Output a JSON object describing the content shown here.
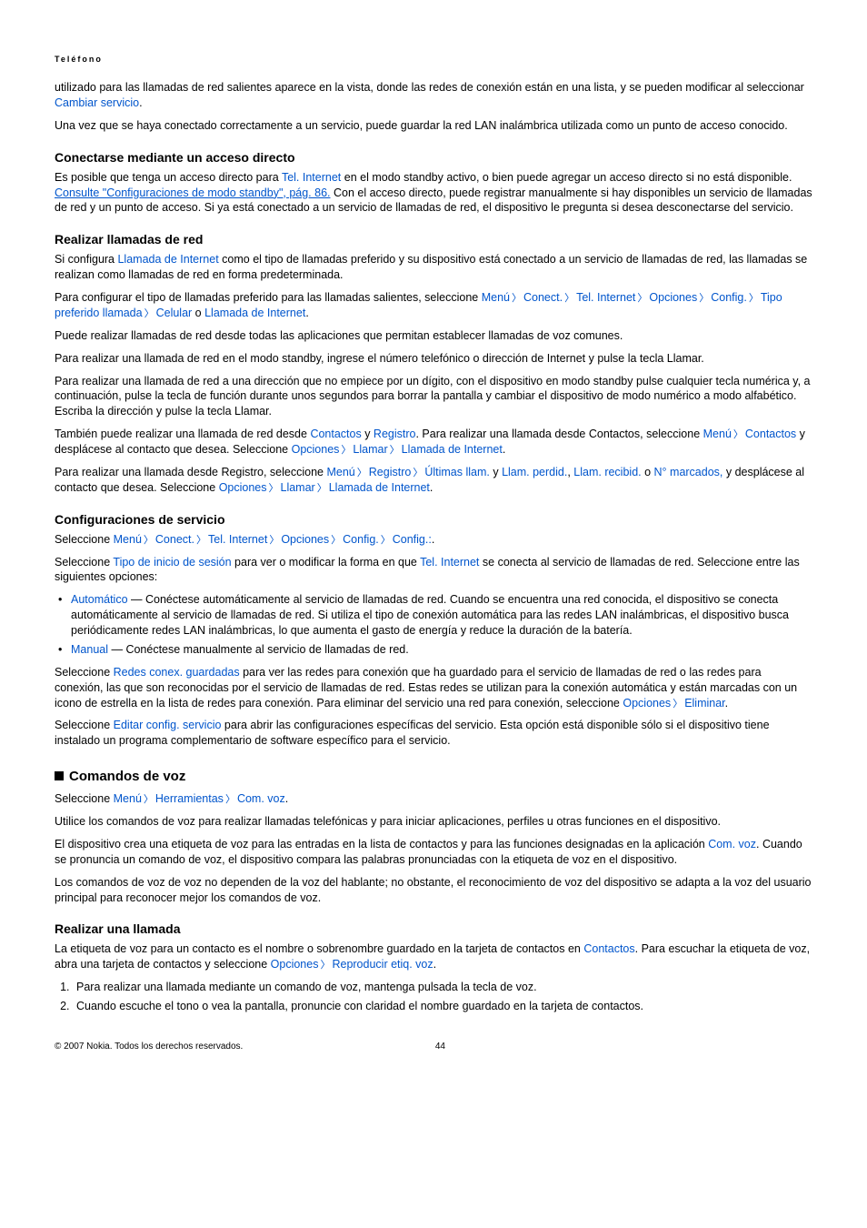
{
  "header": "Teléfono",
  "p1a": "utilizado para las llamadas de red salientes aparece en la vista, donde las redes de conexión están en una lista, y se pueden modificar al seleccionar ",
  "p1_link": "Cambiar servicio",
  "p2": "Una vez que se haya conectado correctamente a un servicio, puede guardar la red LAN inalámbrica utilizada como un punto de acceso conocido.",
  "s1_title": "Conectarse mediante un acceso directo",
  "s1_p1a": "Es posible que tenga un acceso directo para ",
  "s1_p1b": "Tel. Internet",
  "s1_p1c": " en el modo standby activo, o bien puede agregar un acceso directo si no está disponible. ",
  "s1_p1d": "Consulte \"Configuraciones de modo standby\", pág. 86.",
  "s1_p1e": " Con el acceso directo, puede registrar manualmente si hay disponibles un servicio de llamadas de red y un punto de acceso. Si ya está conectado a un servicio de llamadas de red, el dispositivo le pregunta si desea desconectarse del servicio.",
  "s2_title": "Realizar llamadas de red",
  "s2_p1a": "Si configura ",
  "s2_p1b": "Llamada de Internet",
  "s2_p1c": " como el tipo de llamadas preferido y su dispositivo está conectado a un servicio de llamadas de red, las llamadas se realizan como llamadas de red en forma predeterminada.",
  "s2_p2a": "Para configurar el tipo de llamadas preferido para las llamadas salientes, seleccione ",
  "menu": "Menú",
  "conect": "Conect.",
  "tel_internet": "Tel. Internet",
  "opciones": "Opciones",
  "config": "Config.",
  "tipo_pref": "Tipo preferido llamada",
  "celular": "Celular",
  "o_txt": " o ",
  "llamada_internet": "Llamada de Internet",
  "s2_p3": "Puede realizar llamadas de red desde todas las aplicaciones que permitan establecer llamadas de voz comunes.",
  "s2_p4": "Para realizar una llamada de red en el modo standby, ingrese el número telefónico o dirección de Internet y pulse la tecla Llamar.",
  "s2_p5": "Para realizar una llamada de red a una dirección que no empiece por un dígito, con el dispositivo en modo standby pulse cualquier tecla numérica y, a continuación, pulse la tecla de función durante unos segundos para borrar la pantalla y cambiar el dispositivo de modo numérico a modo alfabético. Escriba la dirección y pulse la tecla Llamar.",
  "s2_p6a": "También puede realizar una llamada de red desde ",
  "contactos": "Contactos",
  "y_txt": " y ",
  "registro": "Registro",
  "s2_p6b": ". Para realizar una llamada desde Contactos, seleccione ",
  "s2_p6c": " y desplácese al contacto que desea. Seleccione ",
  "llamar": "Llamar",
  "s2_p7a": "Para realizar una llamada desde Registro, seleccione ",
  "ultimas": "Últimas llam.",
  "llam_perdid": "Llam. perdid.",
  "llam_recibid": "Llam. recibid.",
  "n_marcados": "N° marcados,",
  "s2_p7b": " y desplácese al contacto que desea. Seleccione ",
  "s3_title": "Configuraciones de servicio",
  "s3_p1a": "Seleccione ",
  "config_colon": "Config.:",
  "s3_p2a": "Seleccione ",
  "tipo_inicio": "Tipo de inicio de sesión",
  "s3_p2b": " para ver o modificar la forma en que ",
  "s3_p2c": " se conecta al servicio de llamadas de red. Seleccione entre las siguientes opciones:",
  "bullet1_a": "Automático",
  "bullet1_b": " — Conéctese automáticamente al servicio de llamadas de red. Cuando se encuentra una red conocida, el dispositivo se conecta automáticamente al servicio de llamadas de red. Si utiliza el tipo de conexión automática para las redes LAN inalámbricas, el dispositivo busca periódicamente redes LAN inalámbricas, lo que aumenta el gasto de energía y reduce la duración de la batería.",
  "bullet2_a": "Manual",
  "bullet2_b": " — Conéctese manualmente al servicio de llamadas de red.",
  "s3_p3a": "Seleccione ",
  "redes_conex": "Redes conex. guardadas",
  "s3_p3b": " para ver las redes para conexión que ha guardado para el servicio de llamadas de red o las redes para conexión, las que son reconocidas por el servicio de llamadas de red. Estas redes se utilizan para la conexión automática y están marcadas con un icono de estrella en la lista de redes para conexión. Para eliminar del servicio una red para conexión, seleccione ",
  "eliminar": "Eliminar",
  "s3_p4a": "Seleccione ",
  "editar_conf": "Editar config. servicio",
  "s3_p4b": " para abrir las configuraciones específicas del servicio. Esta opción está disponible sólo si el dispositivo tiene instalado un programa complementario de software específico para el servicio.",
  "s4_title": "Comandos de voz",
  "s4_p1a": "Seleccione ",
  "herramientas": "Herramientas",
  "com_voz": "Com. voz",
  "s4_p2": "Utilice los comandos de voz para realizar llamadas telefónicas y para iniciar aplicaciones, perfiles u otras funciones en el dispositivo.",
  "s4_p3a": "El dispositivo crea una etiqueta de voz para las entradas en la lista de contactos y para las funciones designadas en la aplicación ",
  "s4_p3b": " Cuando se pronuncia un comando de voz, el dispositivo compara las palabras pronunciadas con la etiqueta de voz en el dispositivo.",
  "s4_p4": "Los comandos de voz de voz no dependen de la voz del hablante; no obstante, el reconocimiento de voz del dispositivo se adapta a la voz del usuario principal para reconocer mejor los comandos de voz.",
  "s5_title": "Realizar una llamada",
  "s5_p1a": "La etiqueta de voz para un contacto es el nombre o sobrenombre guardado en la tarjeta de contactos en ",
  "s5_p1b": ". Para escuchar la etiqueta de voz, abra una tarjeta de contactos y seleccione ",
  "reproducir": "Reproducir etiq. voz",
  "ol1": "Para realizar una llamada mediante un comando de voz, mantenga pulsada la tecla de voz.",
  "ol2": "Cuando escuche el tono o vea la pantalla, pronuncie con claridad el nombre guardado en la tarjeta de contactos.",
  "footer_left": "© 2007 Nokia. Todos los derechos reservados.",
  "footer_right": "44"
}
